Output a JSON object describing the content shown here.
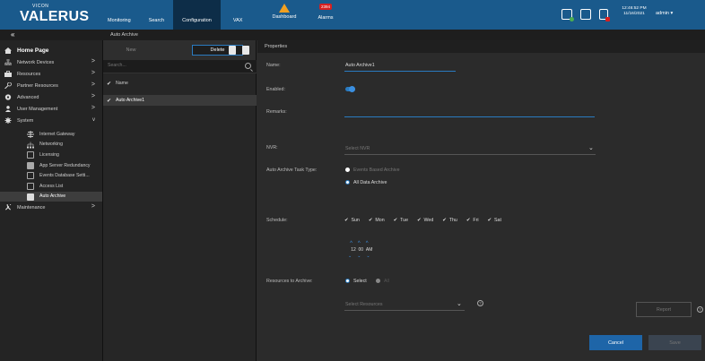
{
  "app": {
    "logo_small": "VICON",
    "logo_big": "VALERUS"
  },
  "nav": {
    "items": [
      "Monitoring",
      "Search",
      "Configuration",
      "VAX"
    ],
    "active": "Configuration",
    "dashboard_label": "Dashboard",
    "alarms_label": "Alarms",
    "alarms_count": "2394"
  },
  "topbar": {
    "time": "12:46:52 PM",
    "date": "11/16/2021",
    "user": "admin"
  },
  "breadcrumb": "Auto Archive",
  "sidebar": {
    "items": [
      {
        "label": "Home Page",
        "icon": "home-icon"
      },
      {
        "label": "Network Devices",
        "icon": "network-devices-icon",
        "chevron": ">"
      },
      {
        "label": "Resources",
        "icon": "resources-icon",
        "chevron": ">"
      },
      {
        "label": "Partner Resources",
        "icon": "partner-resources-icon",
        "chevron": ">"
      },
      {
        "label": "Advanced",
        "icon": "advanced-icon",
        "chevron": ">"
      },
      {
        "label": "User Management",
        "icon": "user-icon",
        "chevron": ">"
      },
      {
        "label": "System",
        "icon": "gear-icon",
        "chevron": "v"
      }
    ],
    "subitems": [
      {
        "label": "Internet Gateway"
      },
      {
        "label": "Networking"
      },
      {
        "label": "Licensing"
      },
      {
        "label": "App Server Redundancy"
      },
      {
        "label": "Events Database Setti..."
      },
      {
        "label": "Access List"
      },
      {
        "label": "Auto Archive"
      }
    ],
    "maintenance": {
      "label": "Maintenance",
      "icon": "maintenance-icon",
      "chevron": ">"
    }
  },
  "list": {
    "new_label": "New",
    "delete_label": "Delete",
    "search_placeholder": "Search...",
    "column_header": "Name",
    "rows": [
      "Auto Archive1"
    ]
  },
  "properties": {
    "header": "Properties",
    "name_label": "Name:",
    "name_value": "Auto Archive1",
    "enabled_label": "Enabled:",
    "remarks_label": "Remarks:",
    "nvr_label": "NVR:",
    "nvr_placeholder": "Select NVR",
    "task_type_label": "Auto Archive Task Type:",
    "task_options": [
      "Events Based Archive",
      "All Data Archive"
    ],
    "schedule_label": "Schedule:",
    "days": [
      "Sun",
      "Mon",
      "Tue",
      "Wed",
      "Thu",
      "Fri",
      "Sat"
    ],
    "time": {
      "hour": "12",
      "minute": "00",
      "ampm": "AM"
    },
    "resources_label": "Resources to Archive:",
    "resource_options": [
      "Select",
      "All"
    ],
    "resources_placeholder": "Select Resources",
    "report_label": "Report",
    "cancel_label": "Cancel",
    "save_label": "Save"
  }
}
